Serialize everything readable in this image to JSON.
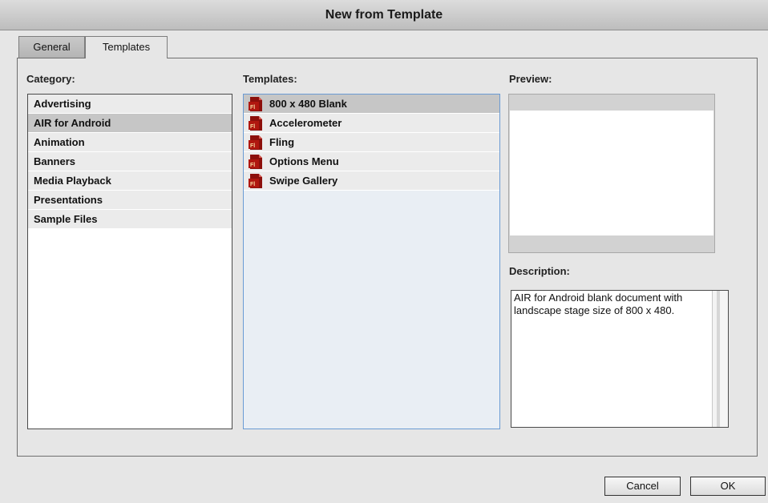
{
  "window": {
    "title": "New from Template"
  },
  "tabs": [
    {
      "label": "General",
      "selected": false
    },
    {
      "label": "Templates",
      "selected": true
    }
  ],
  "category": {
    "label": "Category:",
    "items": [
      "Advertising",
      "AIR for Android",
      "Animation",
      "Banners",
      "Media Playback",
      "Presentations",
      "Sample Files"
    ],
    "selected": "AIR for Android"
  },
  "templates": {
    "label": "Templates:",
    "icon": "fla-file-icon",
    "items": [
      "800 x 480 Blank",
      "Accelerometer",
      "Fling",
      "Options Menu",
      "Swipe Gallery"
    ],
    "selected": "800 x 480 Blank"
  },
  "preview": {
    "label": "Preview:"
  },
  "description": {
    "label": "Description:",
    "text": "AIR for Android blank document with landscape stage size of 800 x 480."
  },
  "buttons": {
    "cancel": "Cancel",
    "ok": "OK"
  },
  "colors": {
    "fla_icon": "#a3140f",
    "templates_border": "#6a9bd4"
  }
}
